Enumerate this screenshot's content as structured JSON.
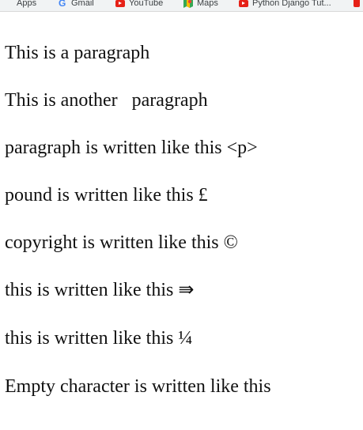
{
  "bookmarks": [
    {
      "label": "Apps",
      "icon": "apps-grid-icon"
    },
    {
      "label": "Gmail",
      "icon": "google-icon"
    },
    {
      "label": "YouTube",
      "icon": "youtube-icon"
    },
    {
      "label": "Maps",
      "icon": "maps-icon"
    },
    {
      "label": "Python Django Tut...",
      "icon": "youtube-icon"
    }
  ],
  "paragraphs": [
    "This is a paragraph",
    "This is another   paragraph",
    "paragraph is written like this <p>",
    "pound is written like this £",
    "copyright is written like this ©",
    "this is written like this ⇛",
    "this is written like this ¼",
    "Empty character is written like this"
  ],
  "colors": {
    "bookmark_bar_bg": "#f1f3f4",
    "text": "#111111",
    "youtube_red": "#e62117",
    "google_blue": "#4285f4"
  }
}
